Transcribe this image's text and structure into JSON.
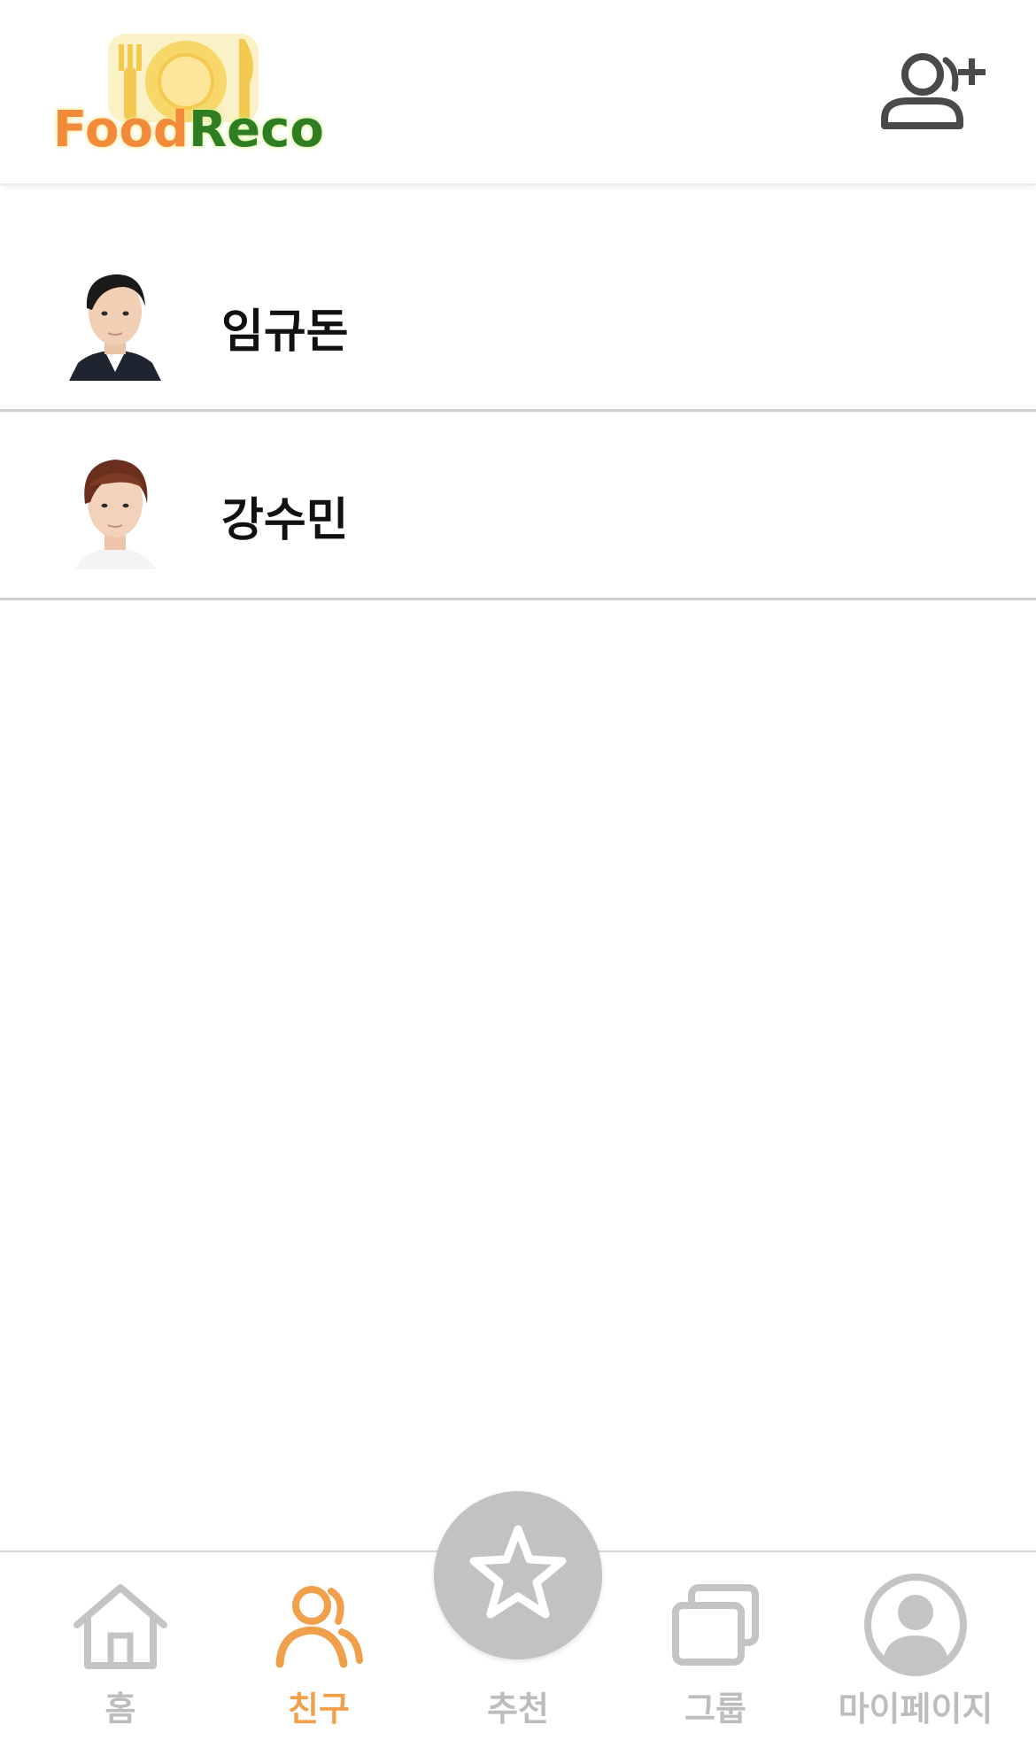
{
  "header": {
    "logo_food": "Food",
    "logo_reco": "Reco",
    "add_friend_icon": "add-user-icon"
  },
  "friends": [
    {
      "name": "임규돈",
      "avatar": "avatar-photo"
    },
    {
      "name": "강수민",
      "avatar": "avatar-photo"
    }
  ],
  "nav": {
    "home": {
      "label": "홈",
      "icon": "home-icon"
    },
    "friends": {
      "label": "친구",
      "icon": "friends-icon",
      "active": true
    },
    "recommend": {
      "label": "추천",
      "icon": "star-icon"
    },
    "group": {
      "label": "그룹",
      "icon": "cards-icon"
    },
    "mypage": {
      "label": "마이페이지",
      "icon": "profile-icon"
    }
  },
  "colors": {
    "accent": "#f0a04b",
    "inactive": "#bdbdbd",
    "fab": "#c2c2c2",
    "logo_food": "#f28a3c",
    "logo_reco": "#2f7d22"
  }
}
